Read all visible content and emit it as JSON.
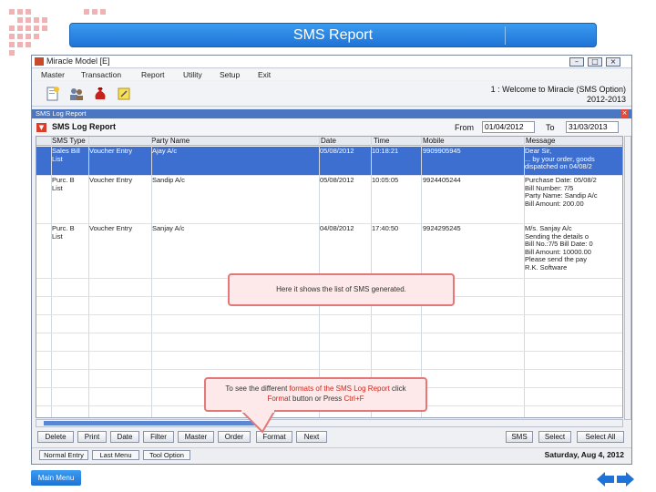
{
  "banner": {
    "title": "SMS Report"
  },
  "window": {
    "title": "Miracle Model [E]",
    "menu": [
      "Master",
      "Transaction",
      "Report",
      "Utility",
      "Setup",
      "Exit"
    ],
    "welcome_line1": "1 : Welcome to Miracle (SMS Option)",
    "welcome_line2": "2012-2013"
  },
  "panel": {
    "header": "SMS Log Report",
    "title": "SMS Log Report",
    "from_label": "From",
    "from_value": "01/04/2012",
    "to_label": "To",
    "to_value": "31/03/2013"
  },
  "table": {
    "columns": [
      "SMS Type",
      "Party Name",
      "Date",
      "Time",
      "Mobile",
      "Message"
    ],
    "rows": [
      {
        "sms_type": "Sales Bill\nList",
        "voucher": "Voucher Entry",
        "party": "Ajay A/c",
        "date": "05/08/2012",
        "time": "10:18:21",
        "mobile": "9909905945",
        "message": "Dear Sir,\n... by your order, goods\ndispatched on 04/08/2"
      },
      {
        "sms_type": "Purc. B\nList",
        "voucher": "Voucher Entry",
        "party": "Sandip A/c",
        "date": "05/08/2012",
        "time": "10:05:05",
        "mobile": "9924405244",
        "message": "Purchase Date: 05/08/2\nBill Number: 7/5\nParty Name: Sandip A/c\nBill Amount: 200.00"
      },
      {
        "sms_type": "Purc. B\nList",
        "voucher": "Voucher Entry",
        "party": "Sanjay A/c",
        "date": "04/08/2012",
        "time": "17:40:50",
        "mobile": "9924295245",
        "message": "M/s. Sanjay A/c\nSending the details o\nBill No.:7/5 Bill Date: 0\nBill Amount: 10000.00\nPlease send the pay\nR.K. Software"
      }
    ]
  },
  "buttons_left": [
    "Delete",
    "Print",
    "Date",
    "Filter",
    "Master",
    "Order",
    "Format",
    "Next"
  ],
  "buttons_right": [
    "SMS",
    "Select",
    "Select All"
  ],
  "status": {
    "buttons": [
      "Normal Entry",
      "Last Menu",
      "Tool Option"
    ],
    "date": "Saturday, Aug 4, 2012"
  },
  "callouts": {
    "list_info": "Here it shows the list of SMS generated.",
    "format_pre": "To see the different ",
    "format_hl1": "formats of the SMS Log Report",
    "format_mid": " click",
    "format_hl2": "Format",
    "format_post": " button or Press ",
    "format_hl3": "Ctrl+F"
  },
  "footer": {
    "main_menu": "Main Menu"
  },
  "colors": {
    "accent": "#1f73d6",
    "selection": "#3c6fd0",
    "callout_border": "#e47777"
  }
}
